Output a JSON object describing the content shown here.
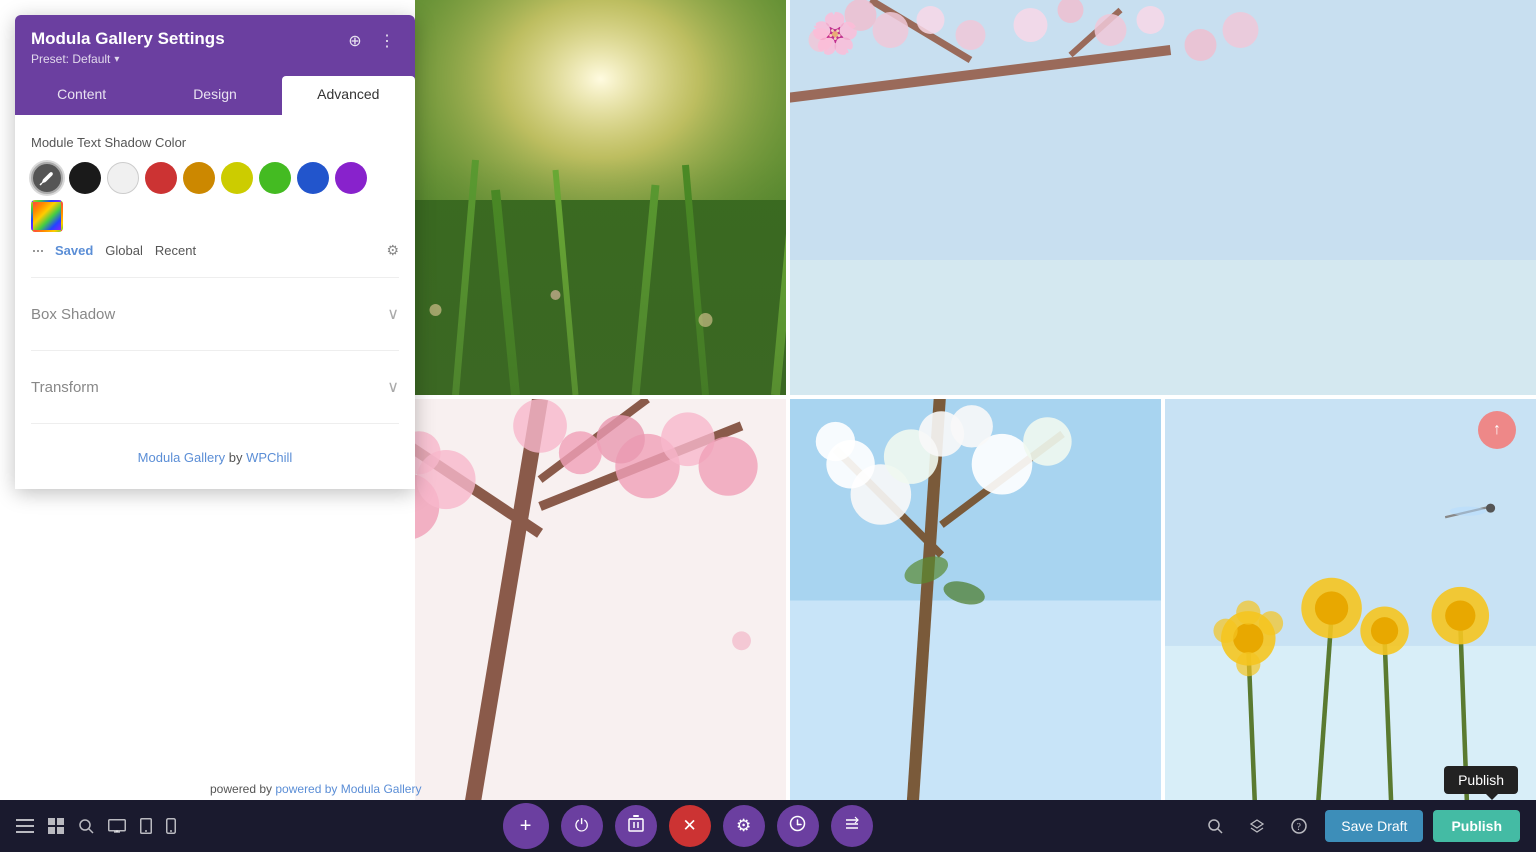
{
  "panel": {
    "title": "Modula Gallery Settings",
    "preset_label": "Preset: Default",
    "preset_arrow": "▾",
    "header_icons": [
      "target-icon",
      "more-icon"
    ],
    "tabs": [
      {
        "id": "content",
        "label": "Content"
      },
      {
        "id": "design",
        "label": "Design"
      },
      {
        "id": "advanced",
        "label": "Advanced"
      }
    ],
    "active_tab": "advanced",
    "color_section": {
      "label": "Module Text Shadow Color",
      "swatches": [
        {
          "id": "eyedropper",
          "label": "eyedropper"
        },
        {
          "id": "black",
          "label": "Black"
        },
        {
          "id": "white",
          "label": "White"
        },
        {
          "id": "red",
          "label": "Red"
        },
        {
          "id": "orange",
          "label": "Orange"
        },
        {
          "id": "yellow",
          "label": "Yellow"
        },
        {
          "id": "green",
          "label": "Green"
        },
        {
          "id": "blue",
          "label": "Blue"
        },
        {
          "id": "purple",
          "label": "Purple"
        },
        {
          "id": "gradient",
          "label": "Gradient"
        }
      ],
      "sub_tabs": [
        "Saved",
        "Global",
        "Recent"
      ],
      "active_sub_tab": "Saved"
    },
    "sections": [
      {
        "id": "box-shadow",
        "label": "Box Shadow"
      },
      {
        "id": "transform",
        "label": "Transform"
      }
    ],
    "footer_text": "Modula Gallery",
    "footer_by": " by ",
    "footer_link": "WPChill"
  },
  "action_bar": {
    "buttons": [
      {
        "id": "close",
        "icon": "✕",
        "type": "red"
      },
      {
        "id": "undo",
        "icon": "↺",
        "type": "gray"
      },
      {
        "id": "redo",
        "icon": "↻",
        "type": "blue"
      },
      {
        "id": "confirm",
        "icon": "✓",
        "type": "teal"
      }
    ]
  },
  "toolbar": {
    "left_icons": [
      "hamburger",
      "grid",
      "search",
      "desktop",
      "tablet",
      "mobile"
    ],
    "center_buttons": [
      {
        "id": "add",
        "icon": "+",
        "size": "large"
      },
      {
        "id": "power",
        "icon": "⏻"
      },
      {
        "id": "trash",
        "icon": "🗑"
      },
      {
        "id": "close",
        "icon": "✕",
        "type": "red"
      },
      {
        "id": "gear",
        "icon": "⚙"
      },
      {
        "id": "clock",
        "icon": "⏱"
      },
      {
        "id": "sort",
        "icon": "⇅"
      }
    ],
    "right_icons": [
      "search",
      "layers",
      "help"
    ],
    "save_draft_label": "Save Draft",
    "publish_label": "Publish"
  },
  "publish_tooltip": "Publish",
  "scroll_up_label": "↑",
  "gallery": {
    "images": [
      {
        "id": "grass",
        "alt": "Grass with sunlight"
      },
      {
        "id": "cherry-blue",
        "alt": "Cherry blossoms with blue sky"
      },
      {
        "id": "pink-cherry",
        "alt": "Pink cherry blossoms"
      },
      {
        "id": "white-flowers",
        "alt": "White spring flowers"
      },
      {
        "id": "sky-flowers",
        "alt": "Sky with yellow flowers"
      }
    ]
  },
  "footer_credit": "powered by Modula Gallery"
}
